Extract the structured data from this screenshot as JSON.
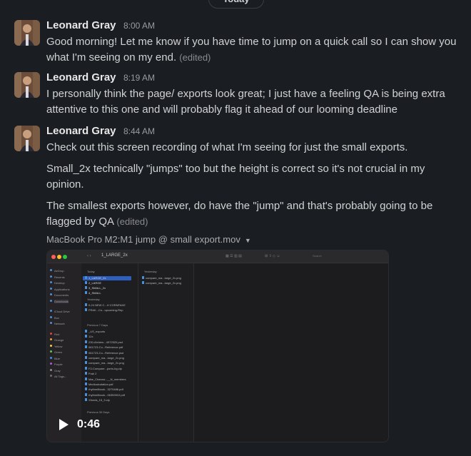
{
  "divider": {
    "label": "Today"
  },
  "messages": [
    {
      "author": "Leonard Gray",
      "time": "8:00 AM",
      "paragraphs": [
        "Good morning! Let me know if you have time to jump on a quick call so I can show you what I'm seeing on my end."
      ],
      "edited_label": "(edited)"
    },
    {
      "author": "Leonard Gray",
      "time": "8:19 AM",
      "paragraphs": [
        "I personally think the page/ exports look great; I just have a feeling QA is being extra attentive to this one and will probably flag it ahead of our looming deadline"
      ]
    },
    {
      "author": "Leonard Gray",
      "time": "8:44 AM",
      "paragraphs": [
        "Check out this screen recording of what I'm seeing for just the small exports.",
        "Small_2x technically \"jumps\" too but the height is correct so it's not crucial in my opinion.",
        "The smallest exports however, do have the \"jump\" and that's probably going to be flagged by QA"
      ],
      "edited_label": "(edited)",
      "attachment": {
        "filename": "MacBook Pro M2:M1 jump @ small export.mov",
        "duration": "0:46",
        "video": {
          "window_title": "1_LARGE_2x",
          "path_label": "1_LARGE_2x",
          "sidebar_items": [
            "AirDrop",
            "Recents",
            "Desktop",
            "Applications",
            "Documents",
            "Downloads",
            "iCloud Drive",
            "Box",
            "Network",
            "Red",
            "Orange",
            "Yellow",
            "Green",
            "Blue",
            "Purple",
            "Gray",
            "All Tags..."
          ],
          "col1_header": "Today",
          "col1_items": [
            "1_LARGE_2x",
            "2_LARGE",
            "3_SMALL_2x",
            "4_SMALL"
          ],
          "col1_sub_header": "Yesterday",
          "col1_sub_items": [
            "0-24 NEW C...H CORNFAKE",
            "FRAK...Co...upcoming-Rep"
          ],
          "col1_prev_header": "Previous 7 Days",
          "col1_prev_items": [
            "_US_exports",
            "12x",
            "230-Alchem...4972520.psd",
            "061723-Co...Reference.pdf",
            "061723-Co...Reference.psd",
            "compare_ma...large_2x.png",
            "compare_ma...large_2x.png",
            "F2-Compare...porto-bg.zip",
            "Frak 2",
            "Mar_Chanxa...__N_members",
            "Medicalcotation.pdf",
            "rhythm8book...3270486.pdf",
            "rhythm8book...06353910.pdf",
            "Xfonds_15_3.zip"
          ],
          "col1_prev30_header": "Previous 30 Days",
          "col2_header": "Yesterday",
          "col2_items": [
            "compare_ma...large_2x.png",
            "compare_ma...large_2x.png"
          ],
          "search_placeholder": "Search"
        }
      }
    }
  ],
  "colors": {
    "background": "#1a1d21",
    "text": "#d1d2d3",
    "muted": "#9a9b9e",
    "finder_highlight": "#2f5fbd"
  },
  "icons": [
    "play-icon",
    "chevron-down-icon"
  ]
}
